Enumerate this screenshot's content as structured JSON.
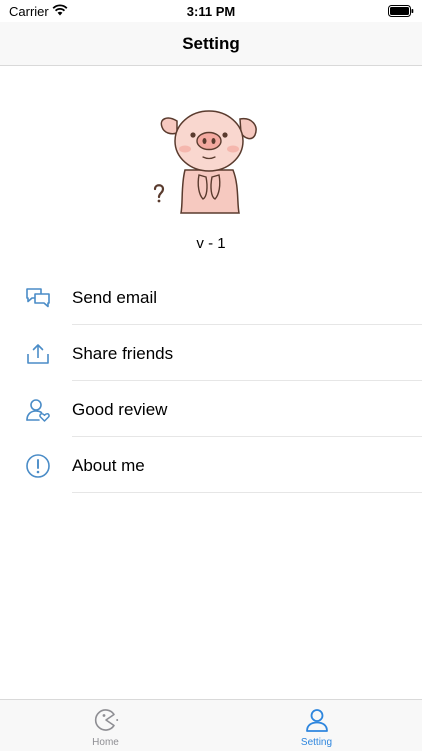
{
  "status_bar": {
    "carrier": "Carrier",
    "time": "3:11 PM"
  },
  "nav": {
    "title": "Setting"
  },
  "app": {
    "version": "v - 1"
  },
  "menu": {
    "items": [
      {
        "label": "Send email",
        "icon": "chat-bubbles-icon"
      },
      {
        "label": "Share friends",
        "icon": "share-icon"
      },
      {
        "label": "Good review",
        "icon": "user-heart-icon"
      },
      {
        "label": "About me",
        "icon": "info-icon"
      }
    ]
  },
  "tabs": [
    {
      "label": "Home",
      "icon": "home-tab-icon",
      "selected": false
    },
    {
      "label": "Setting",
      "icon": "person-icon",
      "selected": true
    }
  ],
  "colors": {
    "accent": "#2e86de",
    "inactive": "#8e8e93",
    "icon_blue": "#4a8cc7"
  }
}
